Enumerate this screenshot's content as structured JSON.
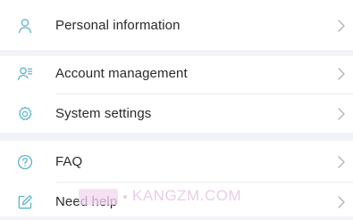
{
  "menu": {
    "personal_info": "Personal information",
    "account_management": "Account management",
    "system_settings": "System settings",
    "faq": "FAQ",
    "need_help": "Need help"
  },
  "icons": {
    "personal_info": "user-icon",
    "account_management": "user-list-icon",
    "system_settings": "gear-icon",
    "faq": "question-circle-icon",
    "need_help": "edit-icon",
    "chevron": "chevron-right-icon"
  },
  "colors": {
    "icon_accent": "#5bb3cc",
    "chevron": "#b4b4b4",
    "text": "#2a2a2a",
    "background": "#f2f3f6"
  },
  "watermark": {
    "text": "KANGZM.COM"
  }
}
